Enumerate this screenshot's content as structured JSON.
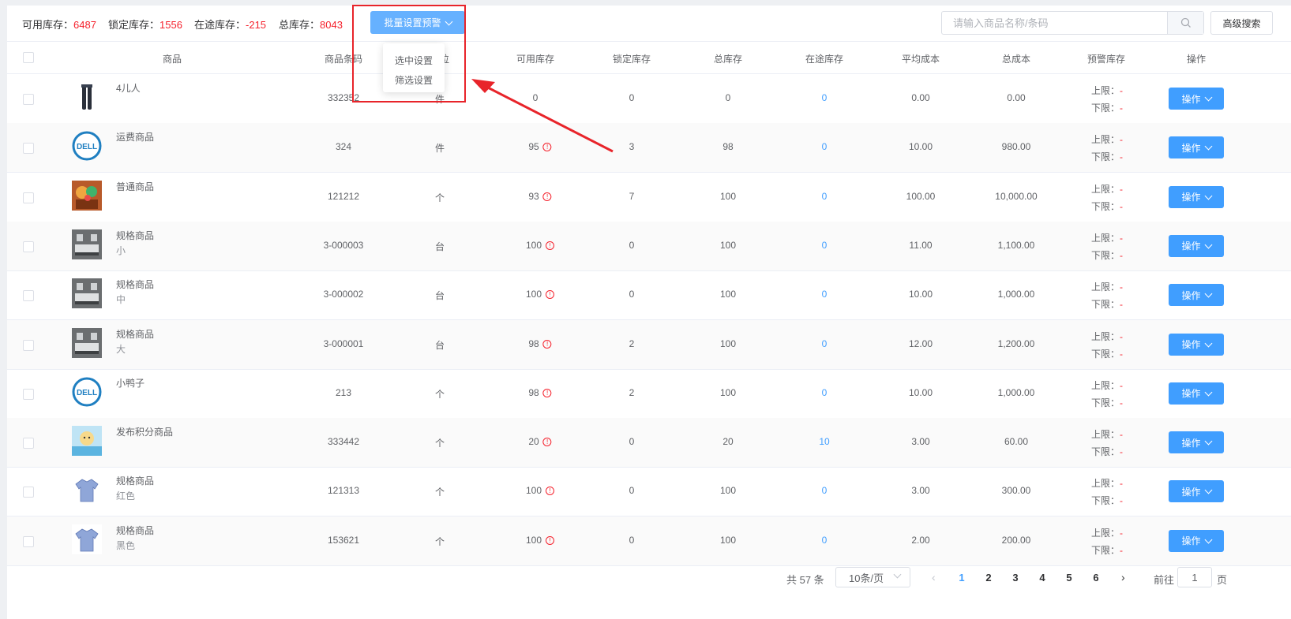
{
  "stats": {
    "available_label": "可用库存：",
    "available_value": "6487",
    "locked_label": "锁定库存：",
    "locked_value": "1556",
    "transit_label": "在途库存：",
    "transit_value": "-215",
    "total_label": "总库存：",
    "total_value": "8043"
  },
  "batch_button": "批量设置预警",
  "dropdown": {
    "item1": "选中设置",
    "item2": "筛选设置"
  },
  "search": {
    "placeholder": "请输入商品名称/条码"
  },
  "advanced_search": "高级搜索",
  "columns": {
    "product": "商品",
    "barcode": "商品条码",
    "unit": "单位",
    "available": "可用库存",
    "locked": "锁定库存",
    "total": "总库存",
    "transit": "在途库存",
    "avg_cost": "平均成本",
    "total_cost": "总成本",
    "warning": "预警库存",
    "action": "操作"
  },
  "limit_labels": {
    "upper": "上限：",
    "lower": "下限：",
    "dash": "-"
  },
  "action_label": "操作",
  "rows": [
    {
      "name": "4儿人",
      "spec": "",
      "barcode": "332352",
      "unit": "件",
      "available": "0",
      "locked": "0",
      "total": "0",
      "transit": "0",
      "avg_cost": "0.00",
      "total_cost": "0.00"
    },
    {
      "name": "运费商品",
      "spec": "",
      "barcode": "324",
      "unit": "件",
      "available": "95",
      "locked": "3",
      "total": "98",
      "transit": "0",
      "avg_cost": "10.00",
      "total_cost": "980.00"
    },
    {
      "name": "普通商品",
      "spec": "",
      "barcode": "121212",
      "unit": "个",
      "available": "93",
      "locked": "7",
      "total": "100",
      "transit": "0",
      "avg_cost": "100.00",
      "total_cost": "10,000.00"
    },
    {
      "name": "规格商品",
      "spec": "小",
      "barcode": "3-000003",
      "unit": "台",
      "available": "100",
      "locked": "0",
      "total": "100",
      "transit": "0",
      "avg_cost": "11.00",
      "total_cost": "1,100.00"
    },
    {
      "name": "规格商品",
      "spec": "中",
      "barcode": "3-000002",
      "unit": "台",
      "available": "100",
      "locked": "0",
      "total": "100",
      "transit": "0",
      "avg_cost": "10.00",
      "total_cost": "1,000.00"
    },
    {
      "name": "规格商品",
      "spec": "大",
      "barcode": "3-000001",
      "unit": "台",
      "available": "98",
      "locked": "2",
      "total": "100",
      "transit": "0",
      "avg_cost": "12.00",
      "total_cost": "1,200.00"
    },
    {
      "name": "小鸭子",
      "spec": "",
      "barcode": "213",
      "unit": "个",
      "available": "98",
      "locked": "2",
      "total": "100",
      "transit": "0",
      "avg_cost": "10.00",
      "total_cost": "1,000.00"
    },
    {
      "name": "发布积分商品",
      "spec": "",
      "barcode": "333442",
      "unit": "个",
      "available": "20",
      "locked": "0",
      "total": "20",
      "transit": "10",
      "avg_cost": "3.00",
      "total_cost": "60.00"
    },
    {
      "name": "规格商品",
      "spec": "红色",
      "barcode": "121313",
      "unit": "个",
      "available": "100",
      "locked": "0",
      "total": "100",
      "transit": "0",
      "avg_cost": "3.00",
      "total_cost": "300.00"
    },
    {
      "name": "规格商品",
      "spec": "黑色",
      "barcode": "153621",
      "unit": "个",
      "available": "100",
      "locked": "0",
      "total": "100",
      "transit": "0",
      "avg_cost": "2.00",
      "total_cost": "200.00"
    }
  ],
  "pagination": {
    "total": "共 57 条",
    "page_size": "10条/页",
    "pages": [
      "1",
      "2",
      "3",
      "4",
      "5",
      "6"
    ],
    "current": "1",
    "goto_label": "前往",
    "goto_value": "1",
    "page_label": "页"
  },
  "colors": {
    "primary": "#409eff",
    "warning_red": "#f5222d",
    "annotation_red": "#e8242a"
  }
}
